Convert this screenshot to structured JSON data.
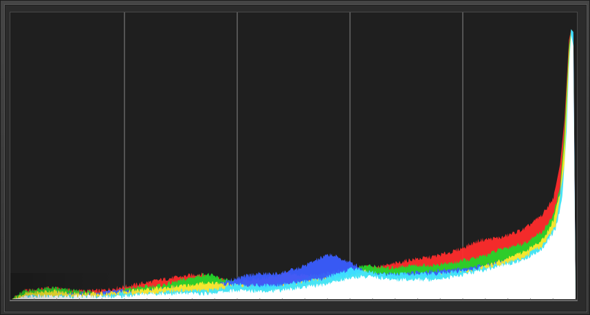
{
  "chart_data": {
    "type": "area",
    "title": "",
    "xlabel": "",
    "ylabel": "",
    "xlim": [
      0,
      255
    ],
    "ylim": [
      0,
      100
    ],
    "grid": true,
    "grid_x": [
      51,
      102,
      153,
      204
    ],
    "legend": "none",
    "series": [
      {
        "color": "#ff2c2c",
        "points": [
          [
            0,
            0
          ],
          [
            6,
            3
          ],
          [
            18,
            4
          ],
          [
            28,
            3
          ],
          [
            40,
            3
          ],
          [
            55,
            5
          ],
          [
            68,
            7
          ],
          [
            85,
            9
          ],
          [
            100,
            6
          ],
          [
            110,
            7
          ],
          [
            125,
            9
          ],
          [
            140,
            8
          ],
          [
            155,
            11
          ],
          [
            170,
            12
          ],
          [
            180,
            14
          ],
          [
            190,
            15
          ],
          [
            200,
            17
          ],
          [
            212,
            21
          ],
          [
            222,
            22
          ],
          [
            232,
            25
          ],
          [
            240,
            30
          ],
          [
            245,
            36
          ],
          [
            248,
            48
          ],
          [
            250,
            64
          ],
          [
            252,
            92
          ],
          [
            253,
            96
          ],
          [
            254,
            88
          ],
          [
            255,
            0
          ]
        ]
      },
      {
        "color": "#23d52a",
        "points": [
          [
            0,
            0
          ],
          [
            6,
            3
          ],
          [
            18,
            4
          ],
          [
            28,
            3
          ],
          [
            40,
            2
          ],
          [
            55,
            4
          ],
          [
            68,
            5
          ],
          [
            78,
            7
          ],
          [
            88,
            9
          ],
          [
            100,
            6
          ],
          [
            115,
            5
          ],
          [
            125,
            6
          ],
          [
            140,
            9
          ],
          [
            150,
            10
          ],
          [
            160,
            12
          ],
          [
            170,
            11
          ],
          [
            180,
            12
          ],
          [
            190,
            12
          ],
          [
            200,
            13
          ],
          [
            212,
            15
          ],
          [
            222,
            18
          ],
          [
            232,
            20
          ],
          [
            240,
            24
          ],
          [
            245,
            30
          ],
          [
            248,
            40
          ],
          [
            250,
            60
          ],
          [
            252,
            90
          ],
          [
            253,
            96
          ],
          [
            254,
            86
          ],
          [
            255,
            0
          ]
        ]
      },
      {
        "color": "#3a5dff",
        "points": [
          [
            0,
            0
          ],
          [
            8,
            1
          ],
          [
            20,
            2
          ],
          [
            35,
            2
          ],
          [
            50,
            3
          ],
          [
            62,
            3
          ],
          [
            75,
            4
          ],
          [
            90,
            5
          ],
          [
            100,
            7
          ],
          [
            110,
            9
          ],
          [
            120,
            9
          ],
          [
            130,
            11
          ],
          [
            138,
            14
          ],
          [
            144,
            16
          ],
          [
            150,
            14
          ],
          [
            156,
            12
          ],
          [
            160,
            10
          ],
          [
            168,
            9
          ],
          [
            176,
            9
          ],
          [
            190,
            10
          ],
          [
            205,
            11
          ],
          [
            220,
            13
          ],
          [
            232,
            16
          ],
          [
            240,
            20
          ],
          [
            246,
            28
          ],
          [
            250,
            50
          ],
          [
            252,
            85
          ],
          [
            253,
            96
          ],
          [
            254,
            94
          ],
          [
            255,
            0
          ]
        ]
      },
      {
        "color": "#ffea2a",
        "points": [
          [
            0,
            0
          ],
          [
            6,
            2
          ],
          [
            18,
            3
          ],
          [
            28,
            2
          ],
          [
            40,
            2
          ],
          [
            55,
            3
          ],
          [
            68,
            4
          ],
          [
            80,
            5
          ],
          [
            90,
            6
          ],
          [
            100,
            5
          ],
          [
            115,
            4
          ],
          [
            125,
            5
          ],
          [
            140,
            7
          ],
          [
            150,
            8
          ],
          [
            160,
            10
          ],
          [
            166,
            8
          ],
          [
            172,
            8
          ],
          [
            180,
            8
          ],
          [
            190,
            8
          ],
          [
            200,
            9
          ],
          [
            212,
            11
          ],
          [
            222,
            14
          ],
          [
            232,
            17
          ],
          [
            240,
            21
          ],
          [
            245,
            28
          ],
          [
            248,
            38
          ],
          [
            250,
            56
          ],
          [
            252,
            88
          ],
          [
            253,
            95
          ],
          [
            254,
            84
          ],
          [
            255,
            0
          ]
        ]
      },
      {
        "color": "#3ee4ff",
        "points": [
          [
            0,
            0
          ],
          [
            8,
            1
          ],
          [
            20,
            1
          ],
          [
            35,
            1
          ],
          [
            50,
            2
          ],
          [
            62,
            2
          ],
          [
            75,
            3
          ],
          [
            88,
            3
          ],
          [
            95,
            4
          ],
          [
            100,
            5
          ],
          [
            110,
            5
          ],
          [
            120,
            5
          ],
          [
            130,
            6
          ],
          [
            140,
            7
          ],
          [
            150,
            10
          ],
          [
            156,
            11
          ],
          [
            160,
            10
          ],
          [
            168,
            9
          ],
          [
            176,
            9
          ],
          [
            190,
            9
          ],
          [
            205,
            10
          ],
          [
            220,
            12
          ],
          [
            232,
            15
          ],
          [
            240,
            19
          ],
          [
            246,
            26
          ],
          [
            250,
            48
          ],
          [
            252,
            84
          ],
          [
            253,
            96
          ],
          [
            254,
            95
          ],
          [
            255,
            0
          ]
        ]
      },
      {
        "color": "#ffffff",
        "points": [
          [
            0,
            0
          ],
          [
            8,
            1
          ],
          [
            20,
            1
          ],
          [
            35,
            1
          ],
          [
            50,
            1
          ],
          [
            62,
            2
          ],
          [
            75,
            2
          ],
          [
            88,
            2
          ],
          [
            100,
            3
          ],
          [
            110,
            3
          ],
          [
            120,
            3
          ],
          [
            130,
            4
          ],
          [
            140,
            5
          ],
          [
            150,
            7
          ],
          [
            158,
            8
          ],
          [
            164,
            8
          ],
          [
            170,
            7
          ],
          [
            180,
            7
          ],
          [
            190,
            7
          ],
          [
            200,
            8
          ],
          [
            212,
            10
          ],
          [
            222,
            12
          ],
          [
            232,
            14
          ],
          [
            240,
            18
          ],
          [
            246,
            25
          ],
          [
            249,
            36
          ],
          [
            251,
            60
          ],
          [
            252,
            82
          ],
          [
            253,
            94
          ],
          [
            254,
            90
          ],
          [
            255,
            0
          ]
        ]
      }
    ]
  }
}
